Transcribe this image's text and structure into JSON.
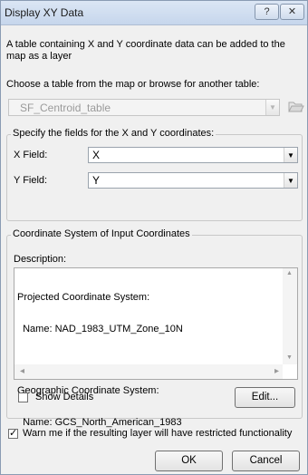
{
  "window": {
    "title": "Display XY Data",
    "help_glyph": "?",
    "close_glyph": "✕"
  },
  "intro_text": "A table containing X and Y coordinate data can be added to the map as a layer",
  "choose_table_label": "Choose a table from the map or browse for another table:",
  "table_combo": {
    "value": "SF_Centroid_table"
  },
  "fields_group": {
    "legend": "Specify the fields for the X and Y coordinates:",
    "x_label": "X Field:",
    "x_value": "X",
    "y_label": "Y Field:",
    "y_value": "Y"
  },
  "coord_group": {
    "legend": "Coordinate System of Input Coordinates",
    "description_label": "Description:",
    "description_lines": [
      "Projected Coordinate System:",
      "  Name: NAD_1983_UTM_Zone_10N",
      "",
      "Geographic Coordinate System:",
      "  Name: GCS_North_American_1983"
    ],
    "show_details_label": "Show Details",
    "show_details_checked": false,
    "edit_button": "Edit..."
  },
  "warn": {
    "label": "Warn me if the resulting layer will have restricted functionality",
    "checked": true,
    "check_glyph": "✓"
  },
  "buttons": {
    "ok": "OK",
    "cancel": "Cancel"
  },
  "glyphs": {
    "dropdown": "▼",
    "scroll_up": "▲",
    "scroll_down": "▼",
    "scroll_left": "◂",
    "scroll_right": "▸"
  }
}
